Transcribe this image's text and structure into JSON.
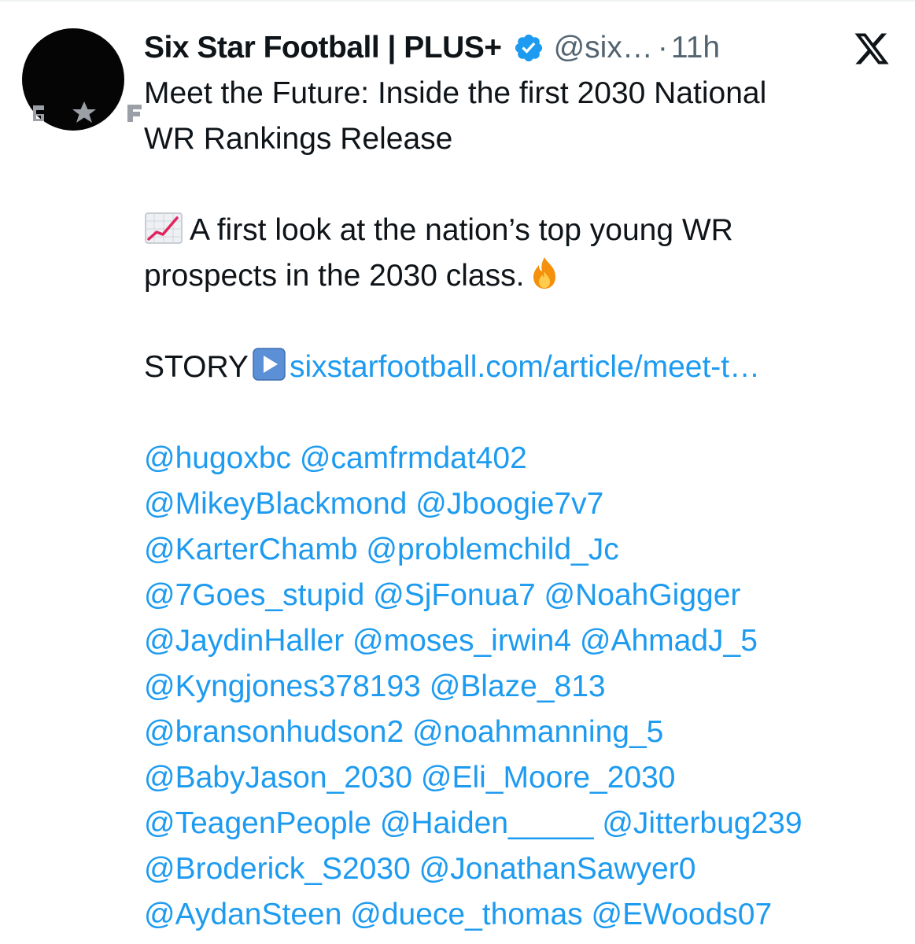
{
  "author": {
    "display_name": "Six Star Football | PLUS+",
    "handle": "@six…",
    "separator": "·",
    "time": "11h",
    "avatar_text": "6★F"
  },
  "post": {
    "title_line_1": "Meet the Future: Inside the first 2030 National",
    "title_line_2": "WR Rankings Release",
    "desc_line_1": "A first look at the nation’s top young WR",
    "desc_line_2": "prospects in the 2030 class.",
    "story_label": "STORY",
    "story_link": "sixstarfootball.com/article/meet-t…"
  },
  "mention_lines": [
    [
      "@hugoxbc",
      "@camfrmdat402"
    ],
    [
      "@MikeyBlackmond",
      "@Jboogie7v7"
    ],
    [
      "@KarterChamb",
      "@problemchild_Jc"
    ],
    [
      "@7Goes_stupid",
      "@SjFonua7",
      "@NoahGigger"
    ],
    [
      "@JaydinHaller",
      "@moses_irwin4",
      "@AhmadJ_5"
    ],
    [
      "@Kyngjones378193",
      "@Blaze_813"
    ],
    [
      "@bransonhudson2",
      "@noahmanning_5"
    ],
    [
      "@BabyJason_2030",
      "@Eli_Moore_2030"
    ],
    [
      "@TeagenPeople",
      "@Haiden_____",
      "@Jitterbug239"
    ],
    [
      "@Broderick_S2030",
      "@JonathanSawyer0"
    ],
    [
      "@AydanSteen",
      "@duece_thomas",
      "@EWoods07"
    ]
  ],
  "icons": {
    "verified": "verified-badge-icon",
    "platform": "x-logo-icon",
    "chart": "chart-increasing-emoji",
    "fire": "fire-emoji",
    "play": "play-button-emoji"
  },
  "colors": {
    "text": "#0f1419",
    "muted": "#536471",
    "link": "#1d9bf0",
    "verified": "#1d9bf0"
  }
}
